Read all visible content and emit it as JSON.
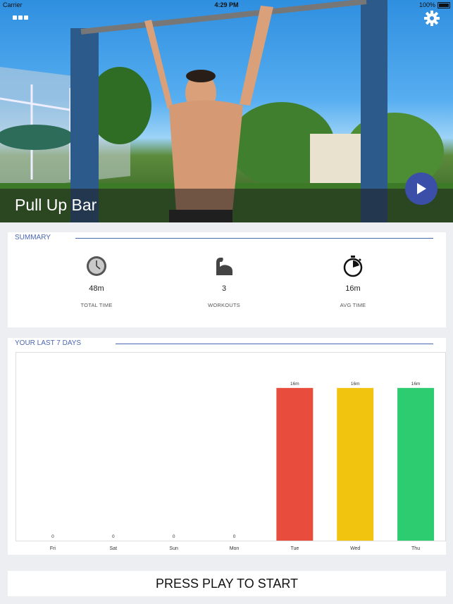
{
  "status_bar": {
    "carrier": "Carrier",
    "time": "4:29 PM",
    "battery": "100%"
  },
  "hero": {
    "title": "Pull Up Bar"
  },
  "summary": {
    "heading": "SUMMARY",
    "stats": [
      {
        "icon": "clock-icon",
        "value": "48m",
        "label": "TOTAL TIME"
      },
      {
        "icon": "flexed-arm-icon",
        "value": "3",
        "label": "WORKOUTS"
      },
      {
        "icon": "stopwatch-icon",
        "value": "16m",
        "label": "AVG TIME"
      }
    ]
  },
  "week": {
    "heading": "YOUR LAST 7 DAYS"
  },
  "chart_data": {
    "type": "bar",
    "categories": [
      "Fri",
      "Sat",
      "Sun",
      "Mon",
      "Tue",
      "Wed",
      "Thu"
    ],
    "values": [
      0,
      0,
      0,
      0,
      16,
      16,
      16
    ],
    "labels": [
      "0",
      "0",
      "0",
      "0",
      "16m",
      "16m",
      "16m"
    ],
    "colors": [
      "#e74c3c",
      "#e74c3c",
      "#e74c3c",
      "#e74c3c",
      "#e74c3c",
      "#f1c40f",
      "#2ecc71"
    ],
    "ylim": [
      0,
      18
    ],
    "grid": false
  },
  "start_button": {
    "label": "PRESS PLAY TO START"
  }
}
